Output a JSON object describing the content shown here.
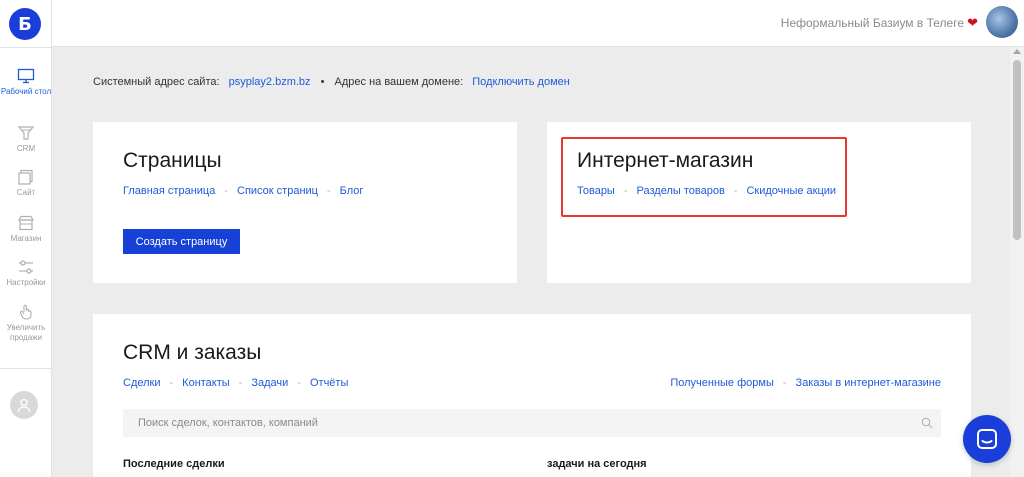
{
  "sidebar": {
    "logo": "Б",
    "items": [
      {
        "label": "Рабочий стол",
        "icon": "monitor-icon"
      },
      {
        "label": "CRM",
        "icon": "funnel-icon"
      },
      {
        "label": "Сайт",
        "icon": "pages-icon"
      },
      {
        "label": "Магазин",
        "icon": "store-icon"
      },
      {
        "label": "Настройки",
        "icon": "sliders-icon"
      },
      {
        "label": "Увеличить продажи",
        "icon": "hand-pointer-icon"
      }
    ]
  },
  "topbar": {
    "link": "Неформальный Базиум в Телеге",
    "heart": "❤"
  },
  "address": {
    "system_label": "Системный адрес сайта:",
    "system_value": "psyplay2.bzm.bz",
    "dot": "•",
    "domain_label": "Адрес на вашем домене:",
    "domain_link": "Подключить домен"
  },
  "pages_card": {
    "title": "Страницы",
    "links": [
      "Главная страница",
      "Список страниц",
      "Блог"
    ],
    "button": "Создать страницу"
  },
  "shop_card": {
    "title": "Интернет-магазин",
    "links": [
      "Товары",
      "Разделы товаров",
      "Скидочные акции"
    ]
  },
  "crm_card": {
    "title": "CRM и заказы",
    "links_left": [
      "Сделки",
      "Контакты",
      "Задачи",
      "Отчёты"
    ],
    "links_right": [
      "Полученные формы",
      "Заказы в интернет-магазине"
    ],
    "search_placeholder": "Поиск сделок, контактов, компаний",
    "recent_deals": "Последние сделки",
    "tasks_today": "задачи на сегодня"
  },
  "colors": {
    "accent": "#1a3ed9",
    "link": "#1e5bd8",
    "highlight": "#e53935"
  }
}
